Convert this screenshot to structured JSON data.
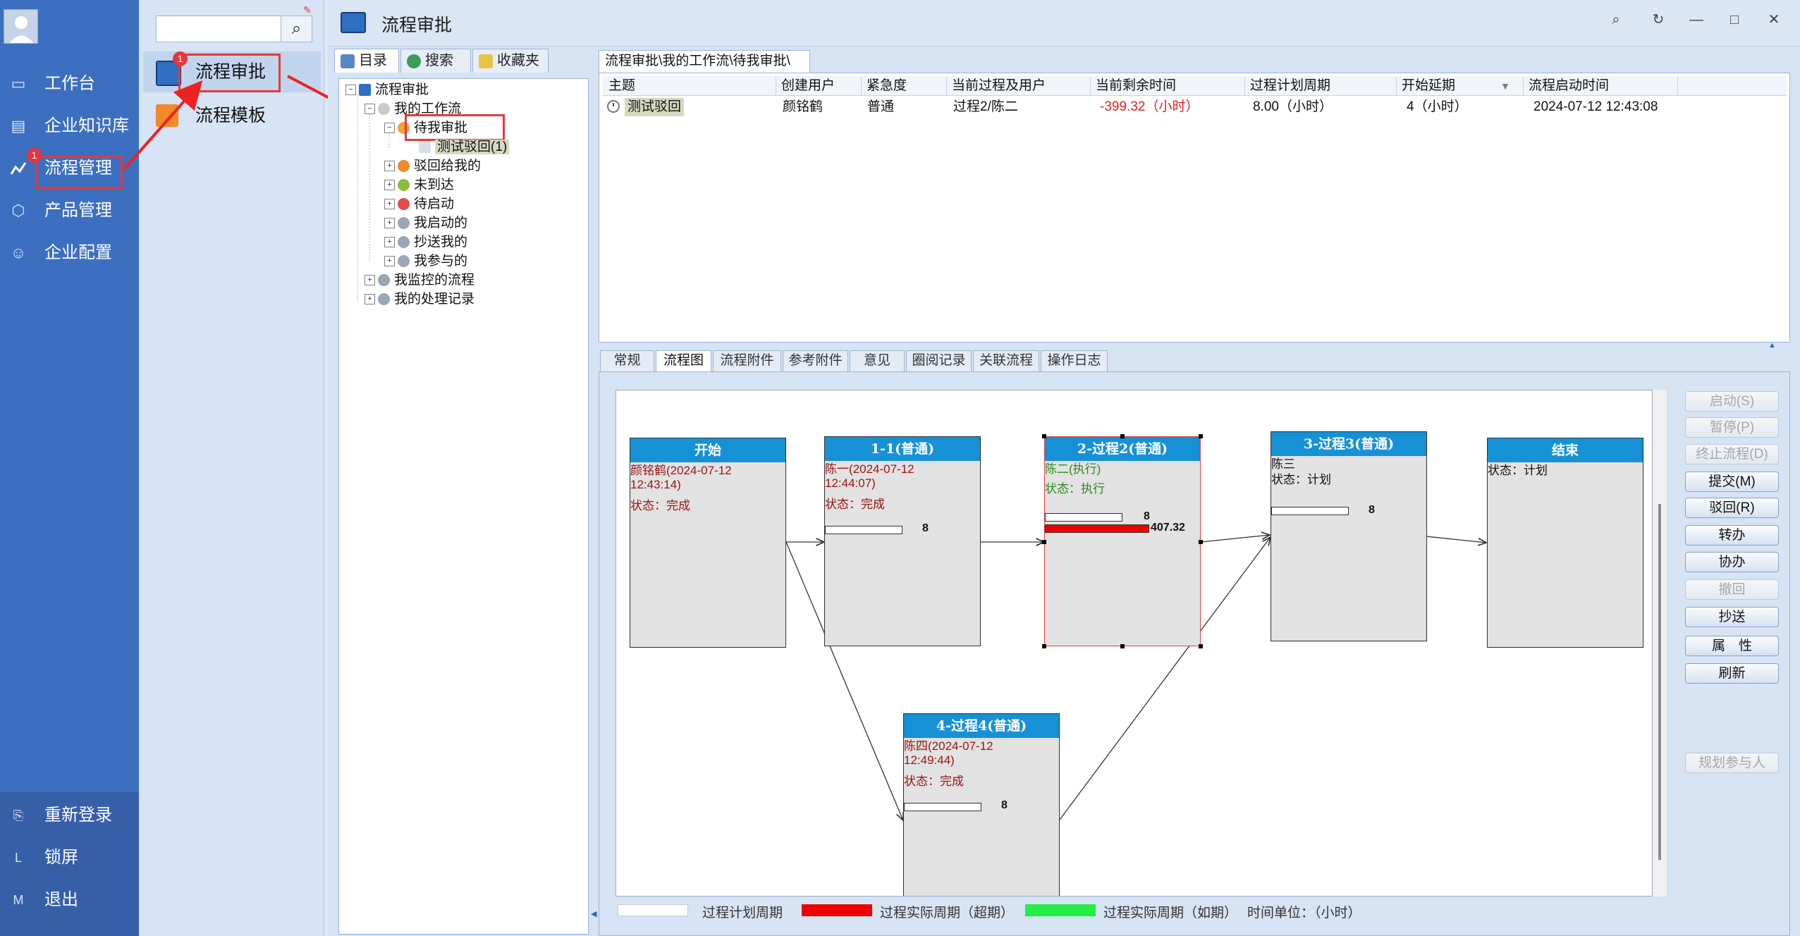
{
  "sidebar": {
    "items": [
      {
        "label": "工作台",
        "icon": "monitor-icon"
      },
      {
        "label": "企业知识库",
        "icon": "book-icon"
      },
      {
        "label": "流程管理",
        "icon": "flow-icon",
        "badge": "1"
      },
      {
        "label": "产品管理",
        "icon": "cube-icon"
      },
      {
        "label": "企业配置",
        "icon": "users-icon"
      }
    ],
    "bottom": [
      {
        "label": "重新登录",
        "icon_glyph": "⎘"
      },
      {
        "label": "锁屏",
        "icon_glyph": "L"
      },
      {
        "label": "退出",
        "icon_glyph": "M"
      }
    ]
  },
  "subpanel": {
    "items": [
      {
        "label": "流程审批",
        "badge": "1"
      },
      {
        "label": "流程模板"
      }
    ]
  },
  "window": {
    "title": "流程审批"
  },
  "tree_tabs": [
    "目录",
    "搜索",
    "收藏夹"
  ],
  "tree": {
    "root": "流程审批",
    "my_workflow": "我的工作流",
    "pending": "待我审批",
    "pending_item": "测试驳回(1)",
    "children": [
      "驳回给我的",
      "未到达",
      "待启动",
      "我启动的",
      "抄送我的",
      "我参与的"
    ],
    "monitor": "我监控的流程",
    "records": "我的处理记录"
  },
  "breadcrumb": "流程审批\\我的工作流\\待我审批\\",
  "list": {
    "columns": [
      "主题",
      "创建用户",
      "紧急度",
      "当前过程及用户",
      "当前剩余时间",
      "过程计划周期",
      "开始延期",
      "流程启动时间"
    ],
    "row": {
      "subject": "测试驳回",
      "creator": "颜铭鹤",
      "urgency": "普通",
      "current": "过程2/陈二",
      "remaining": "-399.32（小时）",
      "plan": "8.00（小时）",
      "delay": "4（小时）",
      "start": "2024-07-12 12:43:08"
    }
  },
  "detail_tabs": [
    "常规",
    "流程图",
    "流程附件",
    "参考附件",
    "意见",
    "圈阅记录",
    "关联流程",
    "操作日志"
  ],
  "flow": {
    "start": {
      "title": "开始",
      "user": "颜铭鹤(2024-07-12\n12:43:14)",
      "status": "状态：完成"
    },
    "n1": {
      "title": "1-1(普通)",
      "user": "陈一(2024-07-12\n12:44:07)",
      "status": "状态：完成",
      "plan": "8"
    },
    "n2": {
      "title": "2-过程2(普通)",
      "user": "陈二(执行)",
      "status": "状态：执行",
      "plan": "8",
      "actual": "407.32"
    },
    "n3": {
      "title": "3-过程3(普通)",
      "user": "陈三",
      "status": "状态：计划",
      "plan": "8"
    },
    "end": {
      "title": "结束",
      "status": "状态：计划"
    },
    "n4": {
      "title": "4-过程4(普通)",
      "user": "陈四(2024-07-12\n12:49:44)",
      "status": "状态：完成",
      "plan": "8"
    }
  },
  "actions": [
    {
      "label": "启动(S)",
      "enabled": false
    },
    {
      "label": "暂停(P)",
      "enabled": false
    },
    {
      "label": "终止流程(D)",
      "enabled": false
    },
    {
      "label": "提交(M)",
      "enabled": true
    },
    {
      "label": "驳回(R)",
      "enabled": true
    },
    {
      "label": "转办",
      "enabled": true
    },
    {
      "label": "协办",
      "enabled": true
    },
    {
      "label": "撤回",
      "enabled": false
    },
    {
      "label": "抄送",
      "enabled": true
    },
    {
      "label": "属　性",
      "enabled": true
    },
    {
      "label": "刷新",
      "enabled": true
    },
    {
      "label": "规划参与人",
      "enabled": false
    }
  ],
  "legend": {
    "plan": "过程计划周期",
    "over": "过程实际周期（超期）",
    "normal": "过程实际周期（如期）",
    "unit": "时间单位：（小时）",
    "colors": {
      "plan": "#ffffff",
      "over": "#ee0000",
      "normal": "#22ee44"
    }
  }
}
